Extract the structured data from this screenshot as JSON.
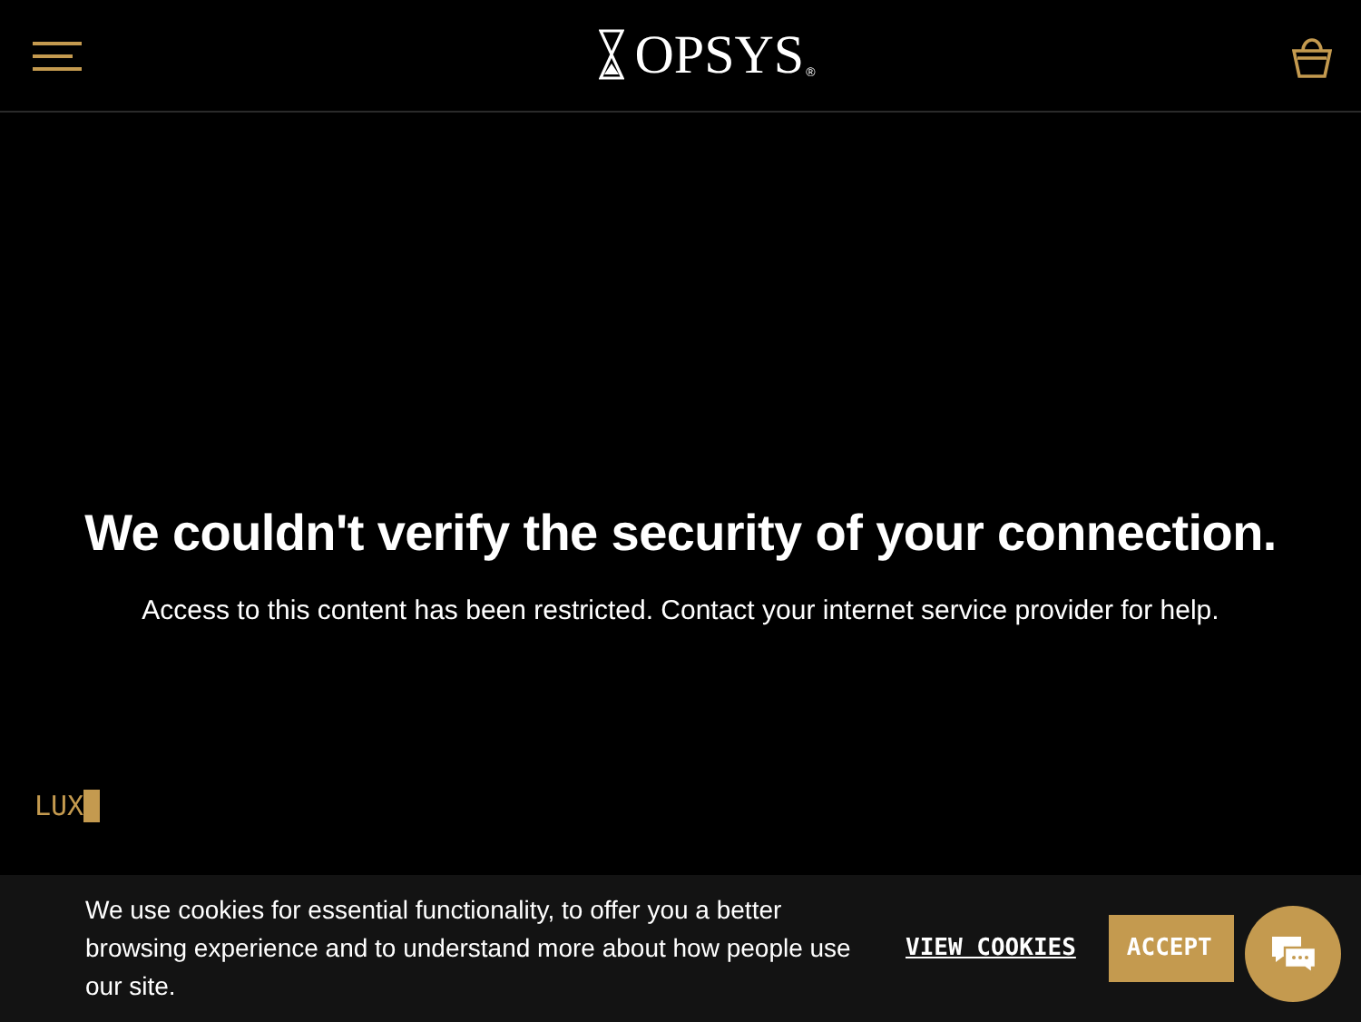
{
  "header": {
    "brand": "OPSYS",
    "brand_mark": "®"
  },
  "message": {
    "title": "We couldn't verify the security of your connection.",
    "body": "Access to this content has been restricted. Contact your internet service provider for help."
  },
  "ticker": {
    "text": "LUX"
  },
  "cookie_banner": {
    "text": "We use cookies for essential functionality, to offer you a better browsing experience and to understand more about how people use our site.",
    "link": "VIEW COOKIES",
    "button": "ACCEPT"
  }
}
